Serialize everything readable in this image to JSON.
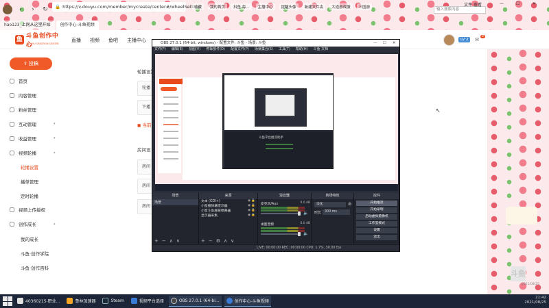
{
  "browser": {
    "url": "https://v.douyu.com/member/mycreate/center#/wheelSetting",
    "bookmarks": [
      "收藏",
      "hao123_上网从这里开始",
      "TL-WDR",
      "我的首页",
      "网页版首页",
      "抖鱼·每...",
      "主播中心",
      "电影·每日",
      "提醒头像",
      "新建文件夹",
      "大道游戏服",
      "辽宁省全网",
      "新开好服网",
      "三国游",
      "游戏全区服"
    ],
    "search_placeholder": "输入搜索内容",
    "tabs": [
      {
        "label": "hao123_上网从这里开始"
      },
      {
        "label": "创作中心-斗鱼视频"
      }
    ],
    "window_controls": {
      "file": "文件",
      "view": "查看",
      "collect": "收藏",
      "tools": "工具",
      "help": "帮助"
    }
  },
  "site": {
    "logo_text": "斗鱼创作中心",
    "logo_sub": "DOUYU CREATION CENTER",
    "nav": [
      "直播",
      "视频",
      "鱼吧",
      "主播中心"
    ],
    "badge": "LV 2",
    "mail_count": "8"
  },
  "sidebar": {
    "upload_label": "投稿",
    "items": [
      {
        "label": "首页"
      },
      {
        "label": "内容管理"
      },
      {
        "label": "粉丝管理"
      },
      {
        "label": "互动管理"
      },
      {
        "label": "收益管理"
      },
      {
        "label": "视频轮播"
      },
      {
        "label": "视频上传授权"
      },
      {
        "label": "创作成长"
      }
    ],
    "subs_wheel": [
      {
        "label": "轮播设置"
      },
      {
        "label": "播单管理"
      },
      {
        "label": "定时轮播"
      }
    ],
    "subs_growth": [
      {
        "label": "我的成长"
      },
      {
        "label": "斗鱼·创作学院"
      },
      {
        "label": "斗鱼·创作百科"
      }
    ]
  },
  "content": {
    "heading": "轮播设置",
    "field1": "轮播",
    "field2": "下播",
    "note": "当前的",
    "section2": "房间设",
    "field3": "房间",
    "field4": "房间",
    "field5": "房间"
  },
  "obs": {
    "title": "OBS 27.0.1 (64-bit, windows) - 配置文件: 斗鱼 - 场景: 斗鱼",
    "menu": [
      "文件(F)",
      "编辑(E)",
      "视图(V)",
      "停靠部件(D)",
      "配置文件(P)",
      "场景集合(S)",
      "工具(T)",
      "帮助(H)",
      "斗鱼·文档"
    ],
    "docks": {
      "scenes": "场景",
      "sources": "来源",
      "mixer": "混音器",
      "transitions": "转场特效",
      "controls": "控件"
    },
    "scene_items": [
      "场景"
    ],
    "source_items": [
      "文本 (GDI+)",
      "小窗播弹幕提示器",
      "小窗斗鱼屏蔽弹幕器",
      "显示器采集"
    ],
    "mixer_tracks": [
      {
        "name": "麦克风/Aux",
        "db": "0.0 dB"
      },
      {
        "name": "桌面音频",
        "db": "0.0 dB"
      }
    ],
    "transition": {
      "type": "淡化",
      "duration_label": "时长",
      "duration": "300 ms"
    },
    "controls": [
      "开始推流",
      "开始录制",
      "启动虚拟摄像机",
      "工作室模式",
      "设置",
      "退出"
    ],
    "status": "LIVE: 00:00:00    REC: 00:00:00    CPU: 1.7%, 30.00 fps",
    "nested_title": "斗鱼平台推流助手"
  },
  "taskbar": {
    "apps": [
      {
        "label": "40360215-职业...",
        "color": "#e0e0e0"
      },
      {
        "label": "鲁林加速器",
        "color": "#f5a623"
      },
      {
        "label": "Steam",
        "color": "#1b2838"
      },
      {
        "label": "视频平台选择",
        "color": "#3a7bd5"
      },
      {
        "label": "OBS 27.0.1 (64-bi...",
        "color": "#444444"
      },
      {
        "label": "创作中心-斗鱼视频",
        "color": "#3a7bd5"
      }
    ],
    "time": "21:42",
    "date": "2021/08/25"
  },
  "right_logo": "斗鱼",
  "colors": {
    "accent": "#f05a28",
    "brand": "#e84a1e",
    "obs_bg": "#2b2e38",
    "taskbar": "#1c2638"
  }
}
